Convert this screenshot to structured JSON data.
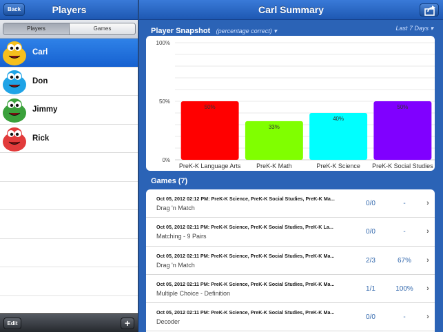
{
  "left": {
    "title": "Players",
    "back_label": "Back",
    "segments": [
      "Players",
      "Games"
    ],
    "players": [
      {
        "name": "Carl",
        "avatar_color": "#f5bf1d",
        "selected": true
      },
      {
        "name": "Don",
        "avatar_color": "#1fa3e6",
        "selected": false
      },
      {
        "name": "Jimmy",
        "avatar_color": "#3aa13b",
        "selected": false
      },
      {
        "name": "Rick",
        "avatar_color": "#e23b3b",
        "selected": false
      }
    ],
    "edit_label": "Edit",
    "add_label": "+"
  },
  "header": {
    "title": "Carl Summary"
  },
  "snapshot": {
    "title": "Player Snapshot",
    "subtitle": "(percentage correct) ▾",
    "range": "Last 7 Days ▾"
  },
  "chart_data": {
    "type": "bar",
    "categories": [
      "PreK-K Language Arts",
      "PreK-K Math",
      "PreK-K Science",
      "PreK-K Social Studies"
    ],
    "values": [
      50,
      33,
      40,
      50
    ],
    "data_labels": [
      "50%",
      "33%",
      "40%",
      "50%"
    ],
    "colors": [
      "#ff0000",
      "#80ff00",
      "#00ffff",
      "#8000ff"
    ],
    "ylim": [
      0,
      100
    ],
    "y_ticks": [
      {
        "value": 0,
        "label": "0%"
      },
      {
        "value": 50,
        "label": "50%"
      },
      {
        "value": 100,
        "label": "100%"
      }
    ],
    "grid": true
  },
  "games": {
    "title": "Games (7)",
    "rows": [
      {
        "title": "Oct 05, 2012  02:12 PM: PreK-K Science, PreK-K Social Studies, PreK-K Ma...",
        "name": "Drag 'n Match",
        "score": "0/0",
        "percent": "-"
      },
      {
        "title": "Oct 05, 2012  02:11 PM: PreK-K Science, PreK-K Social Studies, PreK-K La...",
        "name": "Matching - 9 Pairs",
        "score": "0/0",
        "percent": "-"
      },
      {
        "title": "Oct 05, 2012  02:11 PM: PreK-K Science, PreK-K Social Studies, PreK-K Ma...",
        "name": "Drag 'n Match",
        "score": "2/3",
        "percent": "67%"
      },
      {
        "title": "Oct 05, 2012  02:11 PM: PreK-K Science, PreK-K Social Studies, PreK-K Ma...",
        "name": "Multiple Choice - Definition",
        "score": "1/1",
        "percent": "100%"
      },
      {
        "title": "Oct 05, 2012  02:11 PM: PreK-K Science, PreK-K Social Studies, PreK-K Ma...",
        "name": "Decoder",
        "score": "0/0",
        "percent": "-"
      }
    ]
  }
}
